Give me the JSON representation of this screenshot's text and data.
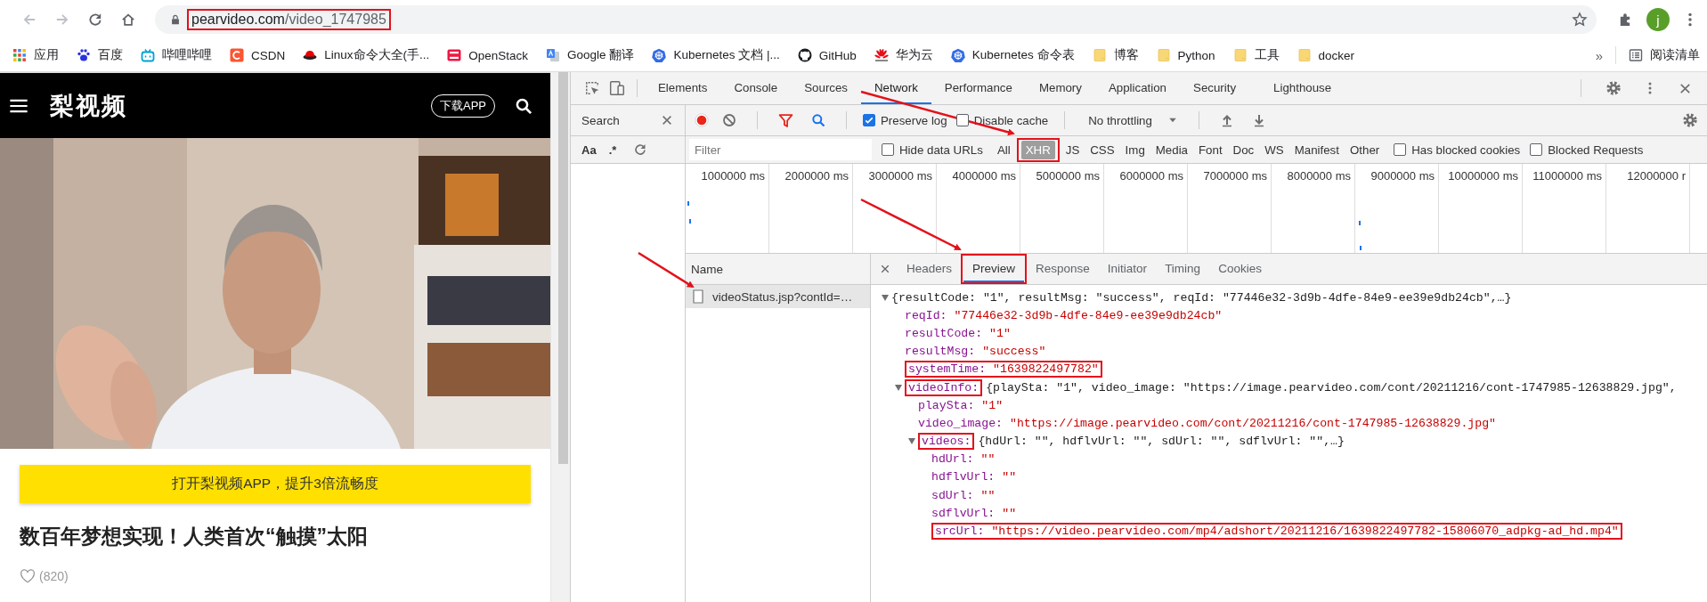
{
  "browser": {
    "nav": [
      {
        "kind": "back",
        "disabled": true
      },
      {
        "kind": "forward",
        "disabled": true
      },
      {
        "kind": "reload",
        "disabled": false
      },
      {
        "kind": "home",
        "disabled": false
      }
    ],
    "url": {
      "host": "pearvideo.com",
      "path": "/video_1747985",
      "annotated": true
    },
    "profile_initial": "j"
  },
  "bookmarks": [
    {
      "label": "应用",
      "kind": "apps"
    },
    {
      "label": "百度",
      "kind": "paw"
    },
    {
      "label": "哔哩哔哩",
      "kind": "tv"
    },
    {
      "label": "CSDN",
      "kind": "csdn"
    },
    {
      "label": "Linux命令大全(手...",
      "kind": "redhat"
    },
    {
      "label": "OpenStack",
      "kind": "openstack"
    },
    {
      "label": "Google 翻译",
      "kind": "translate"
    },
    {
      "label": "Kubernetes 文档 |...",
      "kind": "k8s"
    },
    {
      "label": "GitHub",
      "kind": "github"
    },
    {
      "label": "华为云",
      "kind": "huawei"
    },
    {
      "label": "Kubernetes 命令表",
      "kind": "k8s"
    },
    {
      "label": "博客",
      "kind": "folder"
    },
    {
      "label": "Python",
      "kind": "folder"
    },
    {
      "label": "工具",
      "kind": "folder"
    },
    {
      "label": "docker",
      "kind": "folder"
    }
  ],
  "bookmarks_overflow": "»",
  "reading_list": "阅读清单",
  "page": {
    "logo": "梨视频",
    "download_button": "下载APP",
    "open_app_banner": "打开梨视频APP，提升3倍流畅度",
    "title": "数百年梦想实现！人类首次“触摸”太阳",
    "likes": "(820)"
  },
  "devtools": {
    "tabs": [
      {
        "label": "Elements",
        "selected": false
      },
      {
        "label": "Console",
        "selected": false
      },
      {
        "label": "Sources",
        "selected": false
      },
      {
        "label": "Network",
        "selected": true
      },
      {
        "label": "Performance",
        "selected": false
      },
      {
        "label": "Memory",
        "selected": false
      },
      {
        "label": "Application",
        "selected": false
      },
      {
        "label": "Security",
        "selected": false
      },
      {
        "label": "Lighthouse",
        "selected": false
      }
    ],
    "search_panel": {
      "title": "Search",
      "options": [
        "Aa",
        ".*"
      ]
    },
    "network": {
      "recording": true,
      "filter_active": true,
      "preserve_log": {
        "label": "Preserve log",
        "checked": true
      },
      "disable_cache": {
        "label": "Disable cache",
        "checked": false
      },
      "throttling": "No throttling",
      "filter": {
        "placeholder": "Filter"
      },
      "hide_data_urls": {
        "label": "Hide data URLs",
        "checked": false
      },
      "types": [
        {
          "label": "All",
          "selected": false,
          "annotated": false
        },
        {
          "label": "XHR",
          "selected": true,
          "annotated": true
        },
        {
          "label": "JS",
          "selected": false,
          "annotated": false
        },
        {
          "label": "CSS",
          "selected": false,
          "annotated": false
        },
        {
          "label": "Img",
          "selected": false,
          "annotated": false
        },
        {
          "label": "Media",
          "selected": false,
          "annotated": false
        },
        {
          "label": "Font",
          "selected": false,
          "annotated": false
        },
        {
          "label": "Doc",
          "selected": false,
          "annotated": false
        },
        {
          "label": "WS",
          "selected": false,
          "annotated": false
        },
        {
          "label": "Manifest",
          "selected": false,
          "annotated": false
        },
        {
          "label": "Other",
          "selected": false,
          "annotated": false
        }
      ],
      "has_blocked_cookies": {
        "label": "Has blocked cookies",
        "checked": false
      },
      "blocked_requests": {
        "label": "Blocked Requests",
        "checked": false
      },
      "timeline_ticks": [
        "1000000 ms",
        "2000000 ms",
        "3000000 ms",
        "4000000 ms",
        "5000000 ms",
        "6000000 ms",
        "7000000 ms",
        "8000000 ms",
        "9000000 ms",
        "10000000 ms",
        "11000000 ms",
        "12000000 r"
      ],
      "requests": {
        "column": "Name",
        "rows": [
          {
            "name": "videoStatus.jsp?contId=…",
            "selected": true
          }
        ]
      },
      "detail": {
        "tabs": [
          {
            "label": "Headers",
            "selected": false,
            "annotated": false
          },
          {
            "label": "Preview",
            "selected": true,
            "annotated": true
          },
          {
            "label": "Response",
            "selected": false,
            "annotated": false
          },
          {
            "label": "Initiator",
            "selected": false,
            "annotated": false
          },
          {
            "label": "Timing",
            "selected": false,
            "annotated": false
          },
          {
            "label": "Cookies",
            "selected": false,
            "annotated": false
          }
        ],
        "preview": [
          {
            "summary": "{resultCode: \"1\", resultMsg: \"success\", reqId: \"77446e32-3d9b-4dfe-84e9-ee39e9db24cb\",…}",
            "expanded": true,
            "children": [
              {
                "key": "reqId:",
                "value": "\"77446e32-3d9b-4dfe-84e9-ee39e9db24cb\"",
                "annotated": false
              },
              {
                "key": "resultCode:",
                "value": "\"1\"",
                "annotated": false
              },
              {
                "key": "resultMsg:",
                "value": "\"success\"",
                "annotated": false
              },
              {
                "key": "systemTime:",
                "value": "\"1639822497782\"",
                "annotated": true
              },
              {
                "key": "videoInfo:",
                "summary": "{playSta: \"1\", video_image: \"https://image.pearvideo.com/cont/20211216/cont-1747985-12638829.jpg\",",
                "expanded": true,
                "annotated": true,
                "children": [
                  {
                    "key": "playSta:",
                    "value": "\"1\"",
                    "annotated": false
                  },
                  {
                    "key": "video_image:",
                    "value": "\"https://image.pearvideo.com/cont/20211216/cont-1747985-12638829.jpg\"",
                    "annotated": false
                  },
                  {
                    "key": "videos:",
                    "summary": "{hdUrl: \"\", hdflvUrl: \"\", sdUrl: \"\", sdflvUrl: \"\",…}",
                    "expanded": true,
                    "annotated": true,
                    "children": [
                      {
                        "key": "hdUrl:",
                        "value": "\"\"",
                        "annotated": false
                      },
                      {
                        "key": "hdflvUrl:",
                        "value": "\"\"",
                        "annotated": false
                      },
                      {
                        "key": "sdUrl:",
                        "value": "\"\"",
                        "annotated": false
                      },
                      {
                        "key": "sdflvUrl:",
                        "value": "\"\"",
                        "annotated": false
                      },
                      {
                        "key": "srcUrl:",
                        "value": "\"https://video.pearvideo.com/mp4/adshort/20211216/1639822497782-15806070_adpkg-ad_hd.mp4\"",
                        "annotated": true
                      }
                    ]
                  }
                ]
              }
            ]
          }
        ]
      }
    }
  }
}
